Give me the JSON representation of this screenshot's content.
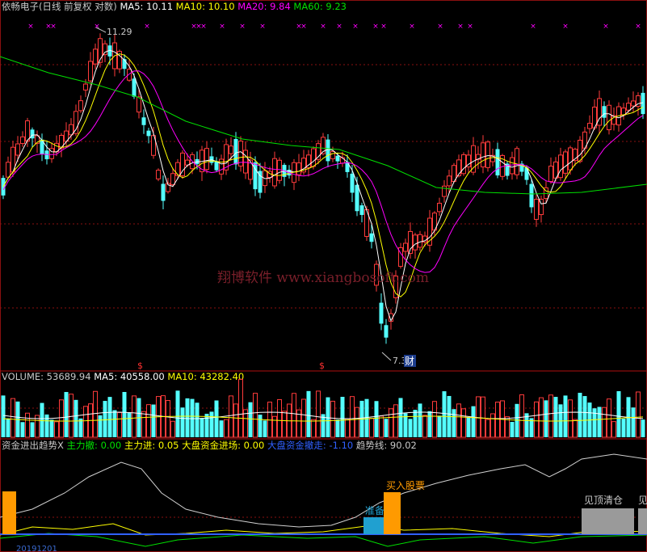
{
  "chart_data": [
    {
      "type": "candlestick",
      "header": [
        {
          "text": "依畅电子(日线 前复权 对数)",
          "color": "#c8c8c8"
        },
        {
          "text": "MA5: 10.11",
          "color": "#ffffff"
        },
        {
          "text": "MA10: 10.10",
          "color": "#ffff00"
        },
        {
          "text": "MA20: 9.84",
          "color": "#ff00ff"
        },
        {
          "text": "MA60: 9.23",
          "color": "#00e000"
        }
      ],
      "ylim": [
        7.0,
        12.0
      ],
      "high_label": "11.29",
      "low_label": "7.30",
      "cai_badge": "财",
      "dollar_marks": [
        "$",
        "$"
      ],
      "watermark": "翔博软件 www.xiangbosoft.com",
      "ma_colors": {
        "ma5": "#ffffff",
        "ma10": "#ffff00",
        "ma20": "#ff00ff",
        "ma60": "#00e000"
      },
      "x_marks": "×"
    },
    {
      "type": "bar",
      "header": [
        {
          "text": "VOLUME: 53689.94",
          "color": "#c8c8c8"
        },
        {
          "text": "MA5: 40558.00",
          "color": "#ffffff"
        },
        {
          "text": "MA10: 43282.40",
          "color": "#ffff00"
        }
      ]
    },
    {
      "type": "line",
      "header": [
        {
          "text": "资金进出趋势X",
          "color": "#c8c8c8"
        },
        {
          "text": "主力撤: 0.00",
          "color": "#00e000"
        },
        {
          "text": "主力进: 0.05",
          "color": "#ffff00"
        },
        {
          "text": "大盘资金进场: 0.00",
          "color": "#ffff00"
        },
        {
          "text": "大盘资金撤走: -1.10",
          "color": "#3060ff"
        },
        {
          "text": "趋势线: 90.02",
          "color": "#c8c8c8"
        }
      ],
      "signals": {
        "buy": "买入股票",
        "prepare": "准备",
        "exit": "见顶清仓",
        "exit_short": "见"
      },
      "date_fragment": "20191201"
    }
  ]
}
